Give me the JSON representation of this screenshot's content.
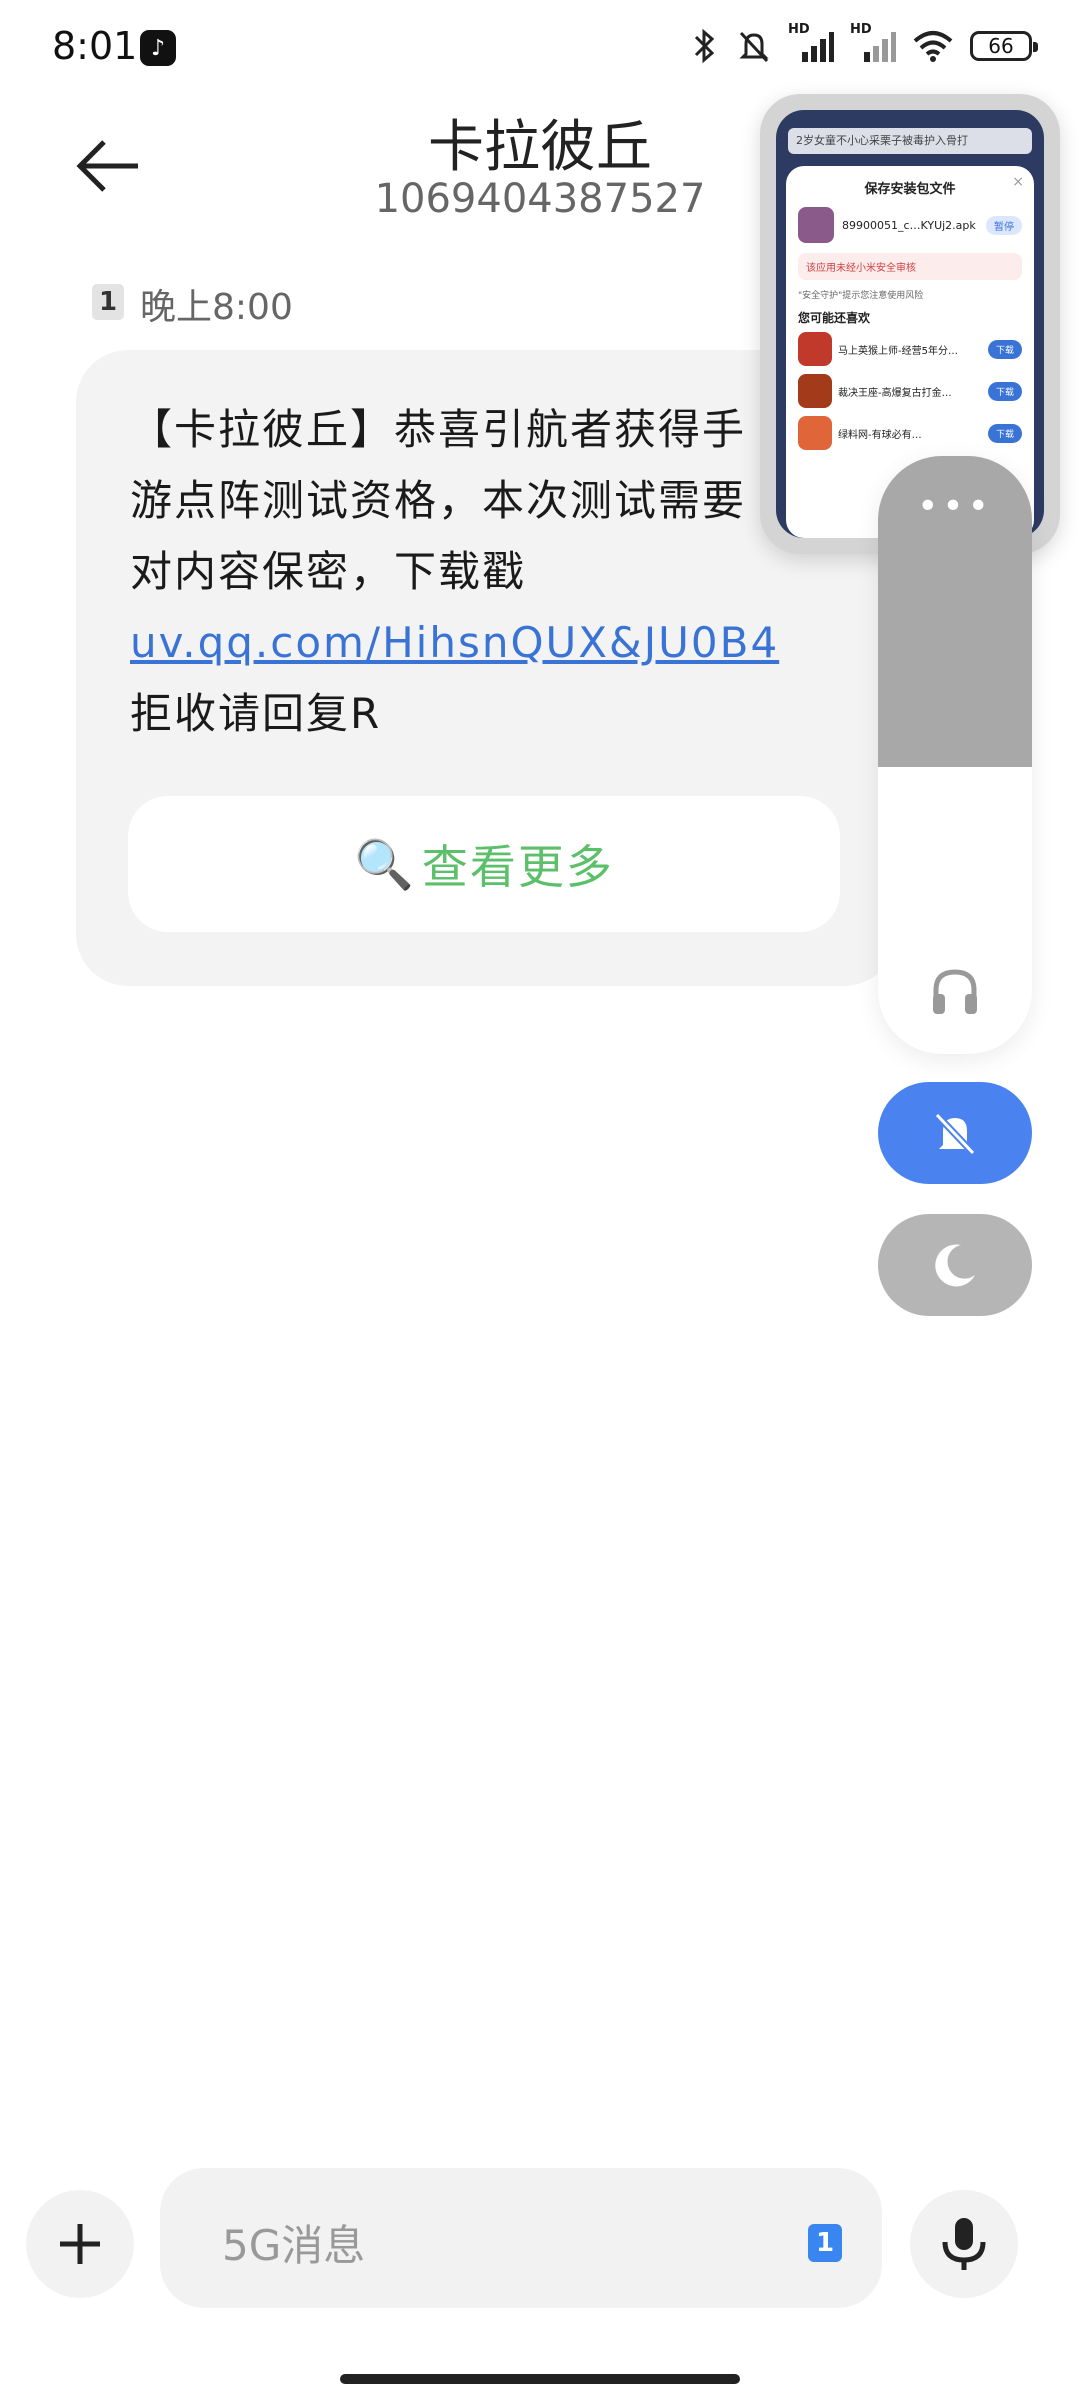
{
  "status_bar": {
    "time": "8:01",
    "app_icon": "tiktok-icon",
    "signal_label_1": "HD",
    "signal_label_2": "HD",
    "battery": "66"
  },
  "header": {
    "sender_name": "卡拉彼丘",
    "sender_number": "1069404387527"
  },
  "message": {
    "sim_slot": "1",
    "time": "晚上8:00",
    "text_before_link": "【卡拉彼丘】恭喜引航者获得手游点阵测试资格，本次测试需要对内容保密，下载戳 ",
    "link": "uv.qq.com/HihsnQUX&JU0B4",
    "footer": "拒收请回复R",
    "view_more_icon": "🔍",
    "view_more_label": "查看更多"
  },
  "floating_preview": {
    "topbar_text": "2岁女童不小心采栗子被毒护入骨打",
    "title": "保存安装包文件",
    "close": "×",
    "filename": "89900051_c…KYUj2.apk",
    "pause": "暂停",
    "warning": "该应用未经小米安全审核",
    "safe_note": "\"安全守护\"提示您注意使用风险",
    "recommend_title": "您可能还喜欢",
    "recommend_items": [
      {
        "name": "马上英猴上师-经营5年分…",
        "action": "下载",
        "color": "#c0392b"
      },
      {
        "name": "裁决王座-高爆复古打金…",
        "action": "下载",
        "color": "#a33a1a"
      },
      {
        "name": "绿料网-有球必有…",
        "action": "下载",
        "color": "#e0663a"
      }
    ]
  },
  "volume_panel": {
    "level": 0.52,
    "more_icon": "•••"
  },
  "input_bar": {
    "placeholder": "5G消息",
    "sim_slot": "1"
  },
  "colors": {
    "accent": "#3a73d6",
    "view_more_green": "#5cbf6a",
    "mute_blue": "#4a83f0"
  }
}
